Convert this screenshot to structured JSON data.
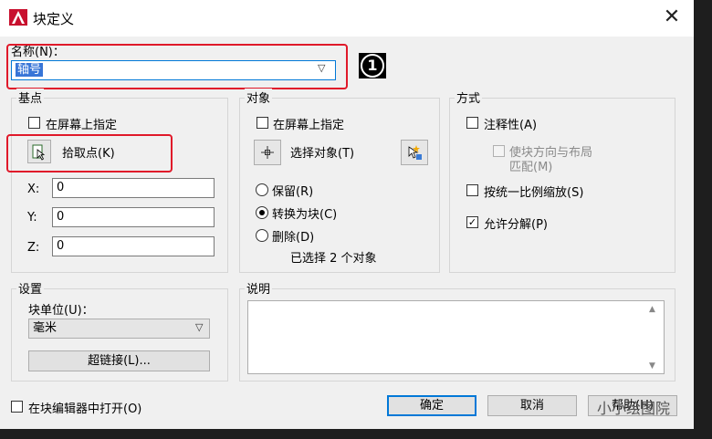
{
  "window": {
    "title": "块定义",
    "close_glyph": "✕"
  },
  "name": {
    "label": "名称(N)：",
    "value": "轴号",
    "annotation": "1"
  },
  "basepoint": {
    "title": "基点",
    "specify_on_screen": "在屏幕上指定",
    "pick_point": "拾取点(K)",
    "x_label": "X:",
    "x_value": "0",
    "y_label": "Y:",
    "y_value": "0",
    "z_label": "Z:",
    "z_value": "0"
  },
  "objects": {
    "title": "对象",
    "specify_on_screen": "在屏幕上指定",
    "select_objects": "选择对象(T)",
    "retain": "保留(R)",
    "convert_to_block": "转换为块(C)",
    "delete": "删除(D)",
    "selected_text": "已选择 2 个对象"
  },
  "behavior": {
    "title": "方式",
    "annotative": "注释性(A)",
    "match_orientation_line1": "使块方向与布局",
    "match_orientation_line2": "匹配(M)",
    "scale_uniformly": "按统一比例缩放(S)",
    "allow_exploding": "允许分解(P)",
    "allow_exploding_checked": true
  },
  "settings": {
    "title": "设置",
    "block_unit_label": "块单位(U)：",
    "block_unit_value": "毫米",
    "hyperlink": "超链接(L)..."
  },
  "description": {
    "title": "说明",
    "value": ""
  },
  "footer": {
    "open_in_editor": "在块编辑器中打开(O)",
    "ok": "确定",
    "cancel": "取消",
    "help": "帮助(H)",
    "watermark": "小小绘图院"
  },
  "colors": {
    "highlight_red": "#e0192a",
    "selection_blue": "#3875d7",
    "accent": "#0078d7"
  }
}
